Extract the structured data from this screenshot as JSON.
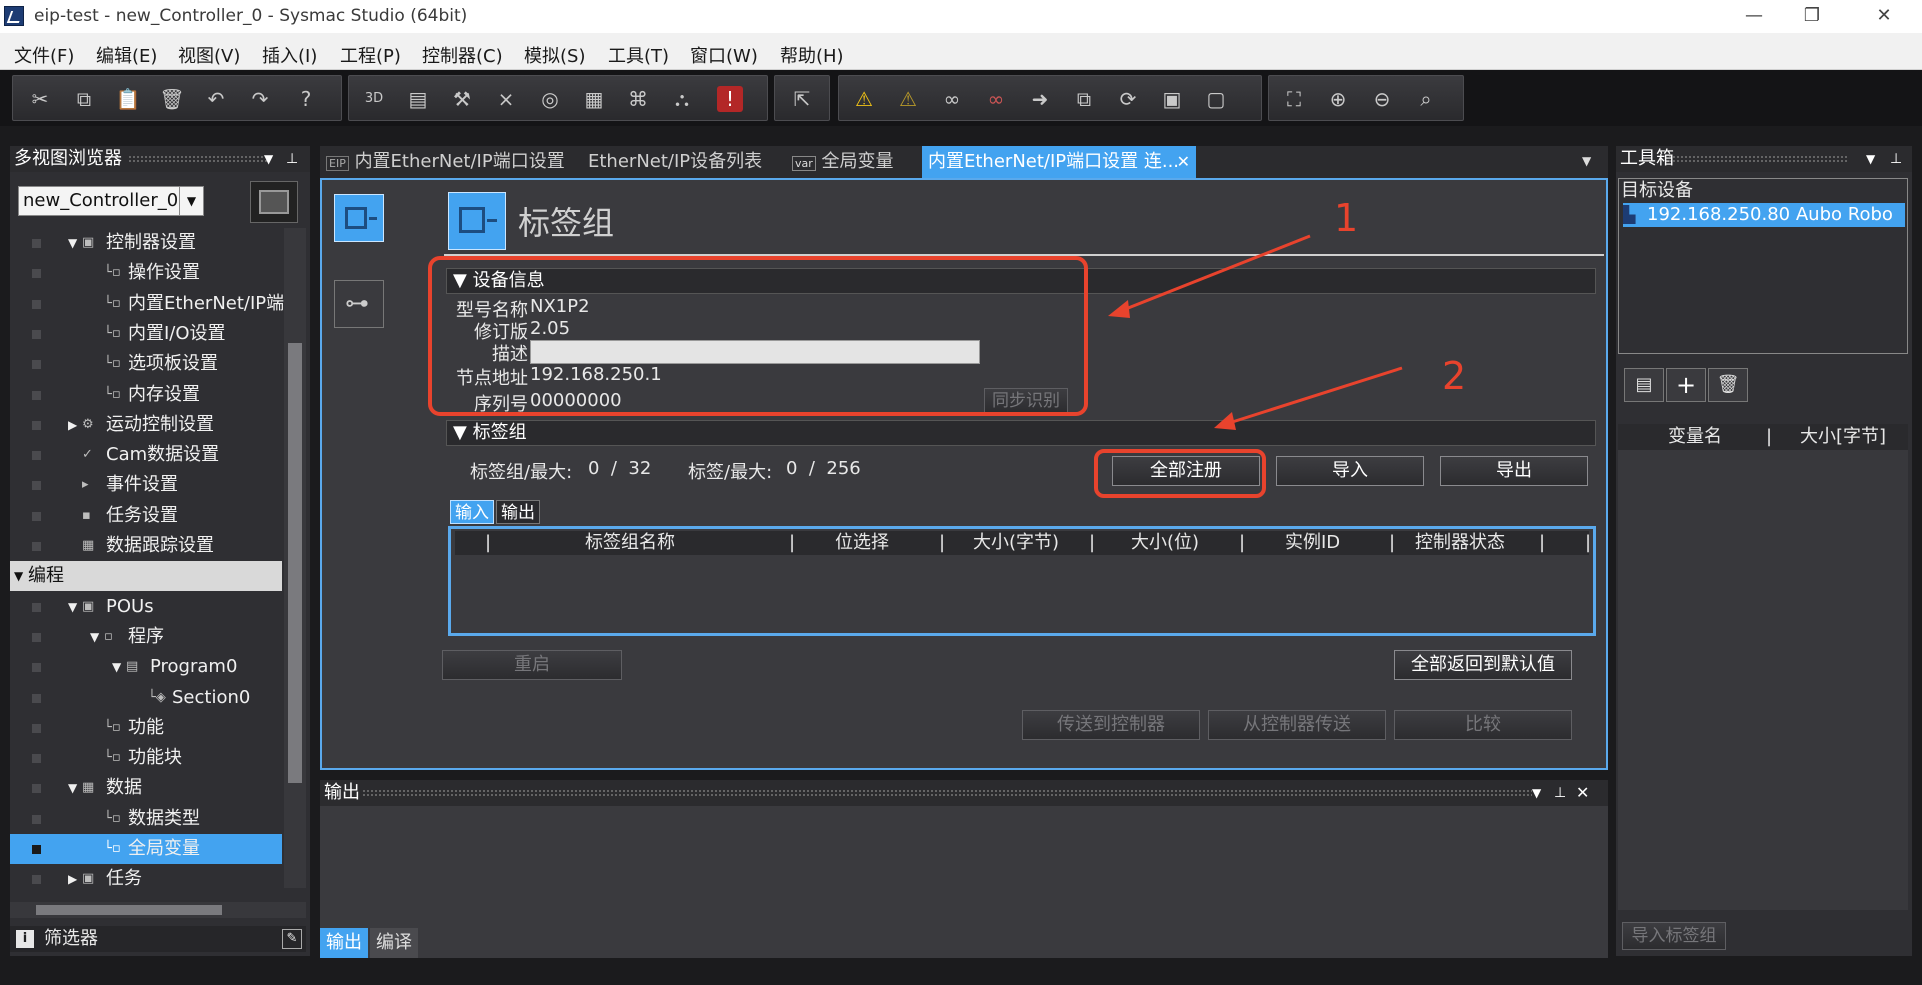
{
  "window": {
    "title": "eip-test - new_Controller_0 - Sysmac Studio (64bit)",
    "minimize": "—",
    "restore": "❐",
    "close": "✕"
  },
  "menu": [
    "文件(F)",
    "编辑(E)",
    "视图(V)",
    "插入(I)",
    "工程(P)",
    "控制器(C)",
    "模拟(S)",
    "工具(T)",
    "窗口(W)",
    "帮助(H)"
  ],
  "toolbar": {
    "groups": [
      [
        "cut-icon",
        "copy-icon",
        "paste-icon",
        "delete-icon",
        "undo-icon",
        "redo-icon",
        "help-icon"
      ],
      [
        "3d-icon",
        "build-icon",
        "tool-icon",
        "cross-ref-icon",
        "watch-icon",
        "table-icon",
        "network-icon",
        "binoculars-icon",
        "error-icon"
      ],
      [
        "online-icon"
      ],
      [
        "warning-icon",
        "warning-off-icon",
        "glasses-icon",
        "glasses-off-icon",
        "transfer-icon",
        "sync-icon",
        "refresh-icon",
        "monitor-icon",
        "monitor-off-icon"
      ],
      [
        "fit-icon",
        "zoom-in-icon",
        "zoom-out-icon",
        "zoom-reset-icon"
      ]
    ],
    "labels": [
      "✂",
      "⧉",
      "📋",
      "🗑",
      "↶",
      "↷",
      "?",
      "3D",
      "▤",
      "⚒",
      "⨯",
      "◎",
      "▦",
      "⌘",
      "⛬",
      "!",
      "⇱",
      "⚠",
      "⚠",
      "∞",
      "∞",
      "➜",
      "⧉",
      "⟳",
      "▣",
      "▢",
      "⛶",
      "⊕",
      "⊖",
      "⌕"
    ]
  },
  "browser": {
    "title": "多视图浏览器",
    "controller_select": "new_Controller_0",
    "tree": [
      {
        "label": "控制器设置",
        "indent": 1,
        "arrow": "▼",
        "icon": "▣"
      },
      {
        "label": "操作设置",
        "indent": 2,
        "icon": "└▫"
      },
      {
        "label": "内置EtherNet/IP端口",
        "indent": 2,
        "icon": "└▫"
      },
      {
        "label": "内置I/O设置",
        "indent": 2,
        "icon": "└▫"
      },
      {
        "label": "选项板设置",
        "indent": 2,
        "icon": "└▫"
      },
      {
        "label": "内存设置",
        "indent": 2,
        "icon": "└▫"
      },
      {
        "label": "运动控制设置",
        "indent": 1,
        "arrow": "▶",
        "icon": "⚙"
      },
      {
        "label": "Cam数据设置",
        "indent": 1,
        "icon": "✓"
      },
      {
        "label": "事件设置",
        "indent": 1,
        "icon": "▸"
      },
      {
        "label": "任务设置",
        "indent": 1,
        "icon": "▪"
      },
      {
        "label": "数据跟踪设置",
        "indent": 1,
        "icon": "▦"
      },
      {
        "label": "编程",
        "indent": 0,
        "arrow": "▼",
        "section": true
      },
      {
        "label": "POUs",
        "indent": 1,
        "arrow": "▼",
        "icon": "▣"
      },
      {
        "label": "程序",
        "indent": 2,
        "arrow": "▼",
        "icon": "▫"
      },
      {
        "label": "Program0",
        "indent": 3,
        "arrow": "▼",
        "icon": "▤"
      },
      {
        "label": "Section0",
        "indent": 4,
        "icon": "└◈"
      },
      {
        "label": "功能",
        "indent": 2,
        "icon": "└▫"
      },
      {
        "label": "功能块",
        "indent": 2,
        "icon": "└▫"
      },
      {
        "label": "数据",
        "indent": 1,
        "arrow": "▼",
        "icon": "▦"
      },
      {
        "label": "数据类型",
        "indent": 2,
        "icon": "└▫"
      },
      {
        "label": "全局变量",
        "indent": 2,
        "icon": "└▫",
        "selected": true
      },
      {
        "label": "任务",
        "indent": 1,
        "arrow": "▶",
        "icon": "▣"
      }
    ],
    "filter_label": "筛选器"
  },
  "tabs": [
    {
      "label": "内置EtherNet/IP端口设置",
      "icon": "EIP"
    },
    {
      "label": "EtherNet/IP设备列表",
      "icon": ""
    },
    {
      "label": "全局变量",
      "icon": "var"
    },
    {
      "label": "内置EtherNet/IP端口设置 连...",
      "icon": "",
      "active": true,
      "close": "✕"
    }
  ],
  "editor": {
    "page_title": "标签组",
    "device_info": {
      "header": "▼ 设备信息",
      "model_label": "型号名称",
      "model_value": "NX1P2",
      "revision_label": "修订版",
      "revision_value": "2.05",
      "description_label": "描述",
      "description_value": "",
      "node_address_label": "节点地址",
      "node_address_value": "192.168.250.1",
      "serial_label": "序列号",
      "serial_value": "00000000",
      "sync_button": "同步识别"
    },
    "tag_groups": {
      "header": "▼ 标签组",
      "count_label": "标签组/最大:",
      "count_value": "0  /  32",
      "tags_label": "标签/最大:",
      "tags_value": "0  /  256",
      "register_all_button": "全部注册",
      "import_button": "导入",
      "export_button": "导出",
      "tab_input": "输入",
      "tab_output": "输出",
      "columns": [
        "标签组名称",
        "位选择",
        "大小(字节)",
        "大小(位)",
        "实例ID",
        "控制器状态"
      ]
    },
    "restart_button": "重启",
    "reset_default_button": "全部返回到默认值",
    "transfer_to_button": "传送到控制器",
    "transfer_from_button": "从控制器传送",
    "compare_button": "比较",
    "annotations": {
      "one": "1",
      "two": "2"
    },
    "annotation_color": "#e8432d"
  },
  "output_panel": {
    "title": "输出",
    "tab_output": "输出",
    "tab_compile": "编译"
  },
  "toolbox": {
    "title": "工具箱",
    "target_label": "目标设备",
    "device_entry": "192.168.250.80   Aubo Robo",
    "col_var": "变量名",
    "col_size": "大小[字节]",
    "import_tags_button": "导入标签组"
  },
  "colors": {
    "accent": "#43a3f0",
    "panel": "#3a3a3e"
  }
}
